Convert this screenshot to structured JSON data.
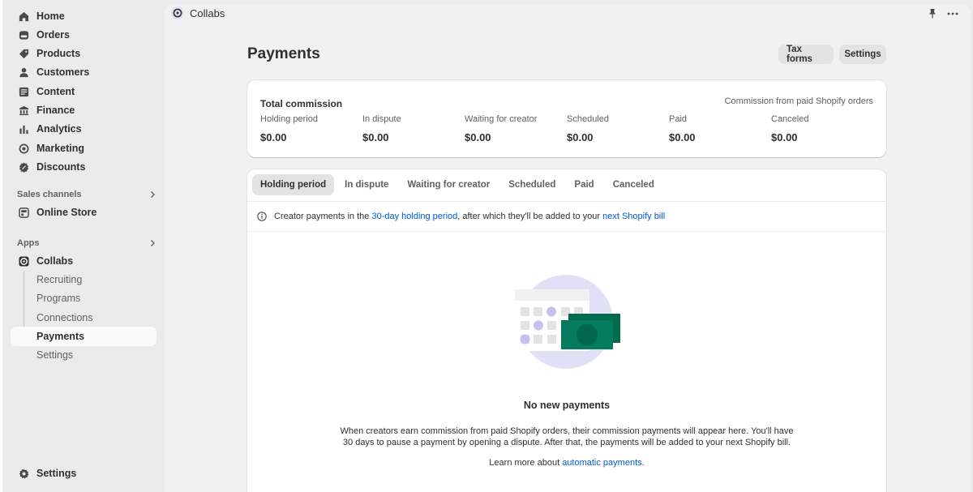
{
  "sidebar": {
    "nav": [
      {
        "label": "Home",
        "icon": "home-icon"
      },
      {
        "label": "Orders",
        "icon": "orders-icon"
      },
      {
        "label": "Products",
        "icon": "tag-icon"
      },
      {
        "label": "Customers",
        "icon": "person-icon"
      },
      {
        "label": "Content",
        "icon": "content-icon"
      },
      {
        "label": "Finance",
        "icon": "bank-icon"
      },
      {
        "label": "Analytics",
        "icon": "bar-chart-icon"
      },
      {
        "label": "Marketing",
        "icon": "target-icon"
      },
      {
        "label": "Discounts",
        "icon": "discount-icon"
      }
    ],
    "sales_channels_label": "Sales channels",
    "online_store_label": "Online Store",
    "apps_label": "Apps",
    "collabs_label": "Collabs",
    "collabs_sub": [
      "Recruiting",
      "Programs",
      "Connections",
      "Payments",
      "Settings"
    ],
    "settings_label": "Settings"
  },
  "topbar": {
    "app_name": "Collabs"
  },
  "page": {
    "title": "Payments",
    "tax_forms_label": "Tax forms",
    "settings_label": "Settings"
  },
  "commission": {
    "title": "Total commission",
    "subtitle": "Commission from paid Shopify orders",
    "stats": [
      {
        "label": "Holding period",
        "value": "$0.00"
      },
      {
        "label": "In dispute",
        "value": "$0.00"
      },
      {
        "label": "Waiting for creator",
        "value": "$0.00"
      },
      {
        "label": "Scheduled",
        "value": "$0.00"
      },
      {
        "label": "Paid",
        "value": "$0.00"
      },
      {
        "label": "Canceled",
        "value": "$0.00"
      }
    ]
  },
  "tabs": [
    "Holding period",
    "In dispute",
    "Waiting for creator",
    "Scheduled",
    "Paid",
    "Canceled"
  ],
  "banner": {
    "text_before": "Creator payments in the ",
    "link1": "30-day holding period",
    "text_middle": ", after which they'll be added to your ",
    "link2": "next Shopify bill"
  },
  "empty_state": {
    "title": "No new payments",
    "text": "When creators earn commission from paid Shopify orders, their commission payments will appear here. You'll have 30 days to pause a payment by opening a dispute. After that, the payments will be added to your next Shopify bill.",
    "learn_before": "Learn more about ",
    "learn_link": "automatic payments",
    "learn_after": "."
  },
  "colors": {
    "accent_link": "#005bd3",
    "brand_green": "#047b5d",
    "illustration_bg": "#e1e0f7"
  }
}
